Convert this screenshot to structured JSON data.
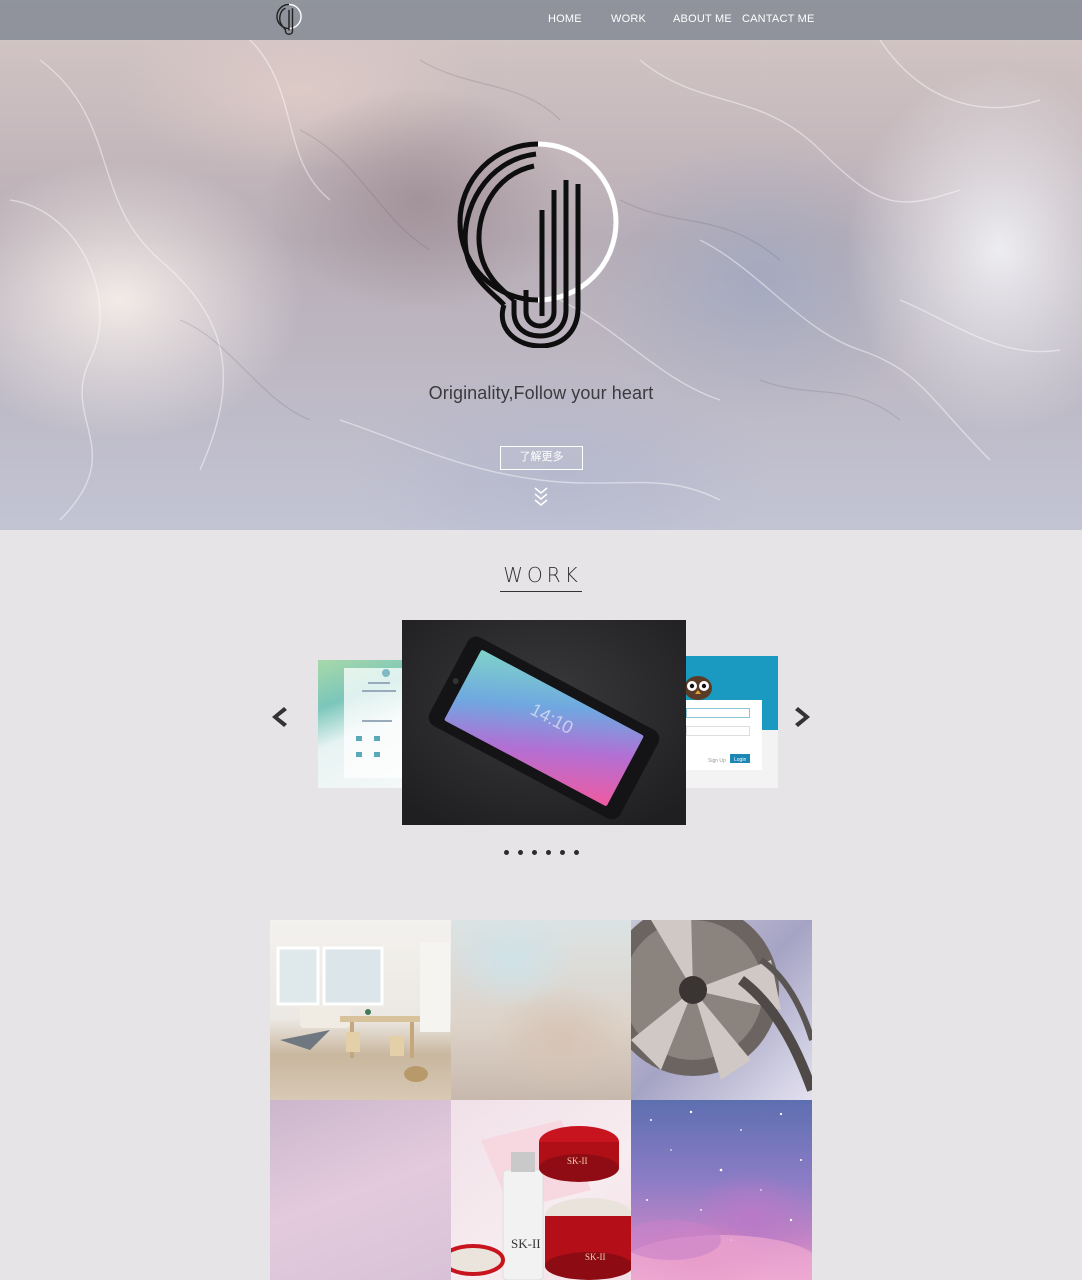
{
  "nav": {
    "items": [
      {
        "label": "HOME"
      },
      {
        "label": "WORK"
      },
      {
        "label": "ABOUT ME"
      },
      {
        "label": "CANTACT ME"
      }
    ]
  },
  "hero": {
    "tagline": "Originality,Follow your heart",
    "cta_label": "了解更多"
  },
  "work": {
    "title": "WORK",
    "carousel": {
      "slide_count": 6,
      "active_index": 0,
      "main_slide": {
        "phone_time": "14:10"
      },
      "right_slide": {
        "signup": "Sign Up",
        "login": "Login"
      }
    }
  },
  "gallery": {
    "tiles": [
      "interior-room",
      "blurred-gradient",
      "film-reel",
      "pink-gradient",
      "skincare-products",
      "galaxy-sky"
    ],
    "product_text": [
      "SK-II",
      "SK-II",
      "SK-II"
    ]
  },
  "colors": {
    "page_bg": "#e6e4e7",
    "navbar_bg": "rgba(118,128,140,0.72)",
    "accent_blue": "#1a9ac0"
  }
}
